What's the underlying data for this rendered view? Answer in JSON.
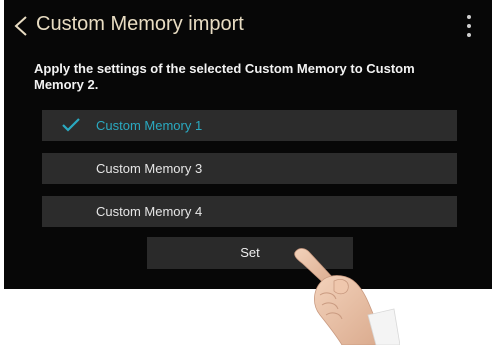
{
  "header": {
    "title": "Custom Memory import",
    "back_icon": "chevron-left-icon",
    "menu_icon": "more-vertical-icon"
  },
  "description": "Apply the settings of the selected Custom Memory to Custom Memory 2.",
  "options": [
    {
      "label": "Custom Memory 1",
      "selected": true
    },
    {
      "label": "Custom Memory 3",
      "selected": false
    },
    {
      "label": "Custom Memory 4",
      "selected": false
    }
  ],
  "set_button": {
    "label": "Set"
  },
  "colors": {
    "background": "#070707",
    "title": "#e8dcc2",
    "accent": "#2aa9c0",
    "row": "#2c2c2c"
  }
}
